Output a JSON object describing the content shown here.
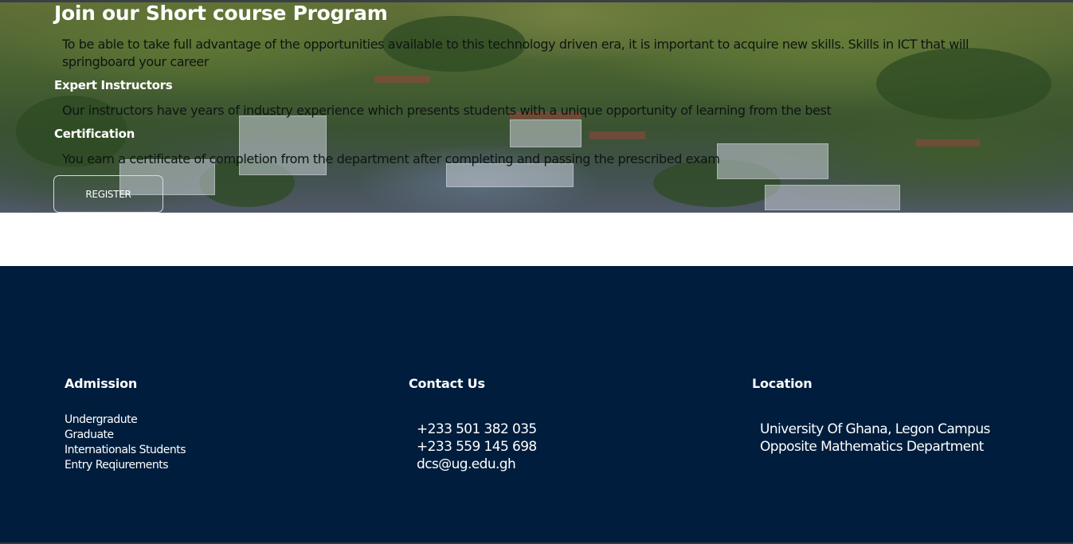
{
  "hero": {
    "title": "Join our Short course Program",
    "intro": "To be able to take full advantage of the opportunities available to this technology driven era, it is important to acquire new skills. Skills in ICT that will springboard your career",
    "instructors_heading": "Expert Instructors",
    "instructors_text": "Our instructors have years of industry experience which presents students with a unique opportunity of learning from the best",
    "certification_heading": "Certification",
    "certification_text": "You earn a certificate of completion from the department after completing and passing the prescribed exam",
    "register_label": "REGISTER"
  },
  "footer": {
    "background_color": "#001d3d",
    "admission": {
      "heading": "Admission",
      "links": [
        "Undergradute",
        "Graduate",
        "Internationals Students",
        "Entry Reqiurements"
      ]
    },
    "contact": {
      "heading": "Contact Us",
      "phone_1": "+233 501 382 035",
      "phone_2": "+233 559 145 698",
      "email": "dcs@ug.edu.gh"
    },
    "location": {
      "heading": "Location",
      "line_1": "University Of Ghana, Legon Campus",
      "line_2": "Opposite Mathematics Department"
    }
  }
}
